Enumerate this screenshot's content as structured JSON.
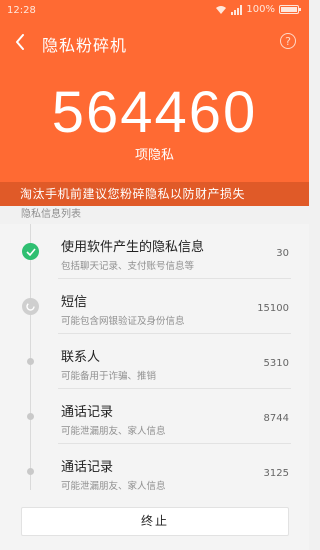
{
  "status_bar": {
    "time": "12:28",
    "battery": "100%",
    "icons": [
      "wifi-icon",
      "signal-icon",
      "battery-icon"
    ]
  },
  "header": {
    "title": "隐私粉碎机",
    "back_icon": "chevron-left-icon",
    "help_label": "?",
    "count": "564460",
    "count_unit": "项隐私"
  },
  "warning": "淘汰手机前建议您粉碎隐私以防财产损失",
  "list_header": "隐私信息列表",
  "items": [
    {
      "title": "使用软件产生的隐私信息",
      "subtitle": "包括聊天记录、支付账号信息等",
      "value": "30",
      "status": "done"
    },
    {
      "title": "短信",
      "subtitle": "可能包含网银验证及身份信息",
      "value": "15100",
      "status": "processing"
    },
    {
      "title": "联系人",
      "subtitle": "可能备用于诈骗、推销",
      "value": "5310",
      "status": "pending"
    },
    {
      "title": "通话记录",
      "subtitle": "可能泄漏朋友、家人信息",
      "value": "8744",
      "status": "pending"
    },
    {
      "title": "通话记录",
      "subtitle": "可能泄漏朋友、家人信息",
      "value": "3125",
      "status": "pending"
    }
  ],
  "footer": {
    "stop_label": "终止"
  },
  "colors": {
    "primary": "#ff6a33",
    "banner": "#e05a28",
    "success": "#2fbf71"
  }
}
